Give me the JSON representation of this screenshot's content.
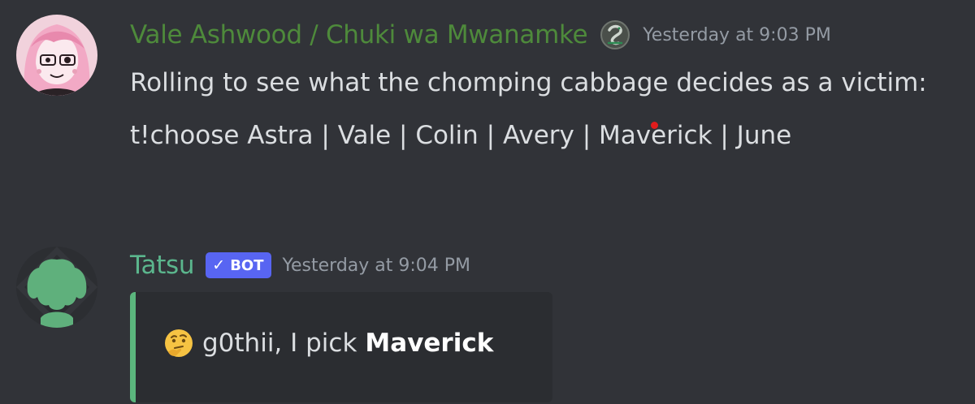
{
  "messages": [
    {
      "username": "Vale Ashwood / Chuki wa Mwanamke",
      "username_color": "#4e8a3b",
      "role_icon": "serpent-badge-icon",
      "timestamp": "Yesterday at 9:03 PM",
      "lines": [
        "Rolling to see what the chomping cabbage decides as a victim:",
        "t!choose Astra | Vale | Colin | Avery | Maverick | June"
      ]
    },
    {
      "username": "Tatsu",
      "username_color": "#5bb68d",
      "bot_tag": "BOT",
      "timestamp": "Yesterday at 9:04 PM",
      "embed": {
        "accent_color": "#5bb67d",
        "emoji": "thinking-face-icon",
        "text": "g0thii, I pick",
        "choice": "Maverick"
      }
    }
  ]
}
